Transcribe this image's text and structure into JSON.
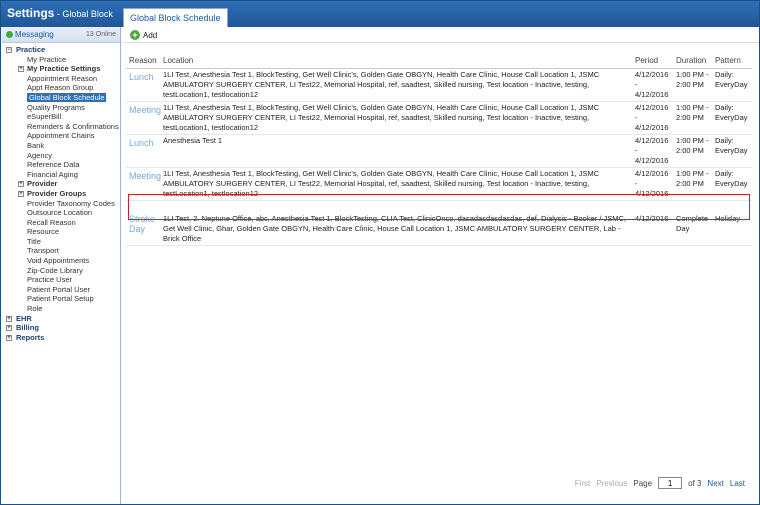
{
  "app": {
    "title": "Settings",
    "subtitle": " - Global Block"
  },
  "tab": {
    "label": "Global Block Schedule"
  },
  "messaging": {
    "label": "Messaging",
    "count": "13 Online"
  },
  "tree": [
    {
      "label": "Practice",
      "level": 0,
      "expander": "−",
      "bold": true
    },
    {
      "label": "My Practice",
      "level": 1
    },
    {
      "label": "My Practice Settings",
      "level": 1,
      "expander": "+",
      "bold": true
    },
    {
      "label": "Appointment Reason",
      "level": 1
    },
    {
      "label": "Appt Reason Group",
      "level": 1
    },
    {
      "label": "Global Block Schedule",
      "level": 1,
      "selected": true
    },
    {
      "label": "Quality Programs",
      "level": 1
    },
    {
      "label": "eSuperBill",
      "level": 1
    },
    {
      "label": "Reminders & Confirmations",
      "level": 1
    },
    {
      "label": "Appointment Chains",
      "level": 1
    },
    {
      "label": "Bank",
      "level": 1
    },
    {
      "label": "Agency",
      "level": 1
    },
    {
      "label": "Reference Data",
      "level": 1
    },
    {
      "label": "Financial Aging",
      "level": 1
    },
    {
      "label": "Provider",
      "level": 1,
      "expander": "+",
      "bold": true
    },
    {
      "label": "Provider Groups",
      "level": 1,
      "expander": "+",
      "bold": true
    },
    {
      "label": "Provider Taxonomy Codes",
      "level": 1
    },
    {
      "label": "Outsource Location",
      "level": 1
    },
    {
      "label": "Recall Reason",
      "level": 1
    },
    {
      "label": "Resource",
      "level": 1
    },
    {
      "label": "Title",
      "level": 1
    },
    {
      "label": "Transport",
      "level": 1
    },
    {
      "label": "Void Appointments",
      "level": 1
    },
    {
      "label": "Zip-Code Library",
      "level": 1
    },
    {
      "label": "Practice User",
      "level": 1
    },
    {
      "label": "Patient Portal User",
      "level": 1
    },
    {
      "label": "Patient Portal Setup",
      "level": 1
    },
    {
      "label": "Role",
      "level": 1
    },
    {
      "label": "EHR",
      "level": 0,
      "expander": "+"
    },
    {
      "label": "Billing",
      "level": 0,
      "expander": "+"
    },
    {
      "label": "Reports",
      "level": 0,
      "expander": "+"
    }
  ],
  "toolbar": {
    "add_label": "Add"
  },
  "table": {
    "headers": [
      "Reason",
      "Location",
      "Period",
      "Duration",
      "Pattern"
    ],
    "rows": [
      {
        "reason": "Lunch",
        "location": "1LI Test, Anesthesia Test 1, BlockTesting, Get Well Clinic's, Golden Gate OBGYN, Health Care Clinic, House Call Location 1, JSMC AMBULATORY SURGERY CENTER, LI Test22, Memorial Hospital, ref, saadtest, Skilled nursing, Test location - Inactive, testing, testLocation1, testlocation12",
        "period": "4/12/2016 - 4/12/2016",
        "duration": "1:00 PM - 2:00 PM",
        "pattern": "Daily: EveryDay"
      },
      {
        "reason": "Meeting",
        "location": "1LI Test, Anesthesia Test 1, BlockTesting, Get Well Clinic's, Golden Gate OBGYN, Health Care Clinic, House Call Location 1, JSMC AMBULATORY SURGERY CENTER, LI Test22, Memorial Hospital, ref, saadtest, Skilled nursing, Test location - Inactive, testing, testLocation1, testlocation12",
        "period": "4/12/2016 - 4/12/2016",
        "duration": "1:00 PM - 2:00 PM",
        "pattern": "Daily: EveryDay"
      },
      {
        "reason": "Lunch",
        "location": "Anesthesia Test 1",
        "period": "4/12/2016 - 4/12/2016",
        "duration": "1:00 PM - 2:00 PM",
        "pattern": "Daily: EveryDay"
      },
      {
        "reason": "Meeting",
        "location": "1LI Test, Anesthesia Test 1, BlockTesting, Get Well Clinic's, Golden Gate OBGYN, Health Care Clinic, House Call Location 1, JSMC AMBULATORY SURGERY CENTER, LI Test22, Memorial Hospital, ref, saadtest, Skilled nursing, Test location - Inactive, testing, testLocation1, testlocation12",
        "period": "4/12/2016 - 4/12/2016",
        "duration": "1:00 PM - 2:00 PM",
        "pattern": "Daily: EveryDay"
      },
      {
        "reason": "Stroke Day",
        "location": "1LI Test, 2. Neptune Office, abc, Anesthesia Test 1, BlockTesting, CLIA Test, ClinicOnco, dasadasdasdasdas, def, Dialysis - Booker / JSMC, Get Well Clinic, Ghar, Golden Gate OBGYN, Health Care Clinic, House Call Location 1, JSMC AMBULATORY SURGERY CENTER, Lab - Brick Office",
        "period": "4/12/2016",
        "duration": "Complete Day",
        "pattern": "Holiday"
      }
    ]
  },
  "pager": {
    "first": "First",
    "previous": "Previous",
    "page_label": "Page",
    "page_value": "1",
    "of_label": "of 3",
    "next": "Next",
    "last": "Last"
  }
}
